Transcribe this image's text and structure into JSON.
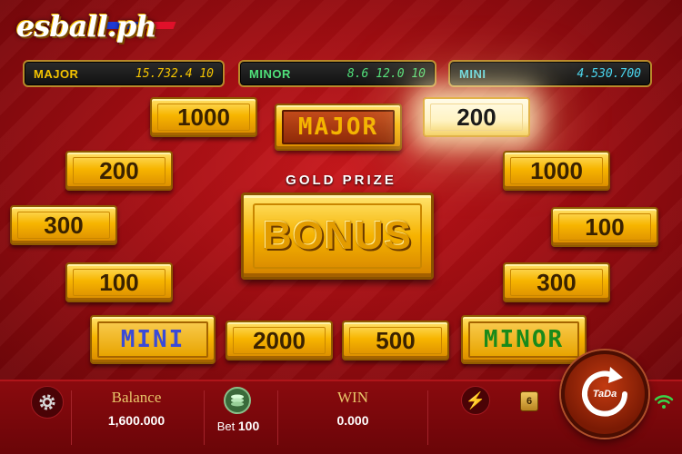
{
  "logo": {
    "text": "esball.ph"
  },
  "jackpots": {
    "major": {
      "label": "MAJOR",
      "value": "15.732.4 10"
    },
    "minor": {
      "label": "MINOR",
      "value": "8.6 12.0 10"
    },
    "mini": {
      "label": "MINI",
      "value": "4.530.700"
    }
  },
  "tiles": {
    "t1000_left": "1000",
    "major": "MAJOR",
    "t200_lit": "200",
    "t200_left": "200",
    "t1000_right": "1000",
    "t300_left": "300",
    "t100_right": "100",
    "t100_left": "100",
    "t300_right": "300",
    "mini": "MINI",
    "t2000": "2000",
    "t500": "500",
    "minor": "MINOR"
  },
  "center": {
    "gold_prize": "GOLD PRIZE",
    "bonus": "BONUS"
  },
  "bottom": {
    "balance_label": "Balance",
    "balance_value": "1,600.000",
    "bet_label": "Bet",
    "bet_value": "100",
    "win_label": "WIN",
    "win_value": "0.000",
    "badge_count": "6",
    "spin_label": "TaDa"
  },
  "icons": [
    "gear-icon",
    "chip-stack-icon",
    "lightning-icon",
    "spin-arrow-icon",
    "wifi-icon"
  ],
  "colors": {
    "major": "#f5c400",
    "minor": "#4fe07a",
    "mini": "#4ad7f0",
    "gold": "#f7b500",
    "background": "#a10d12"
  }
}
